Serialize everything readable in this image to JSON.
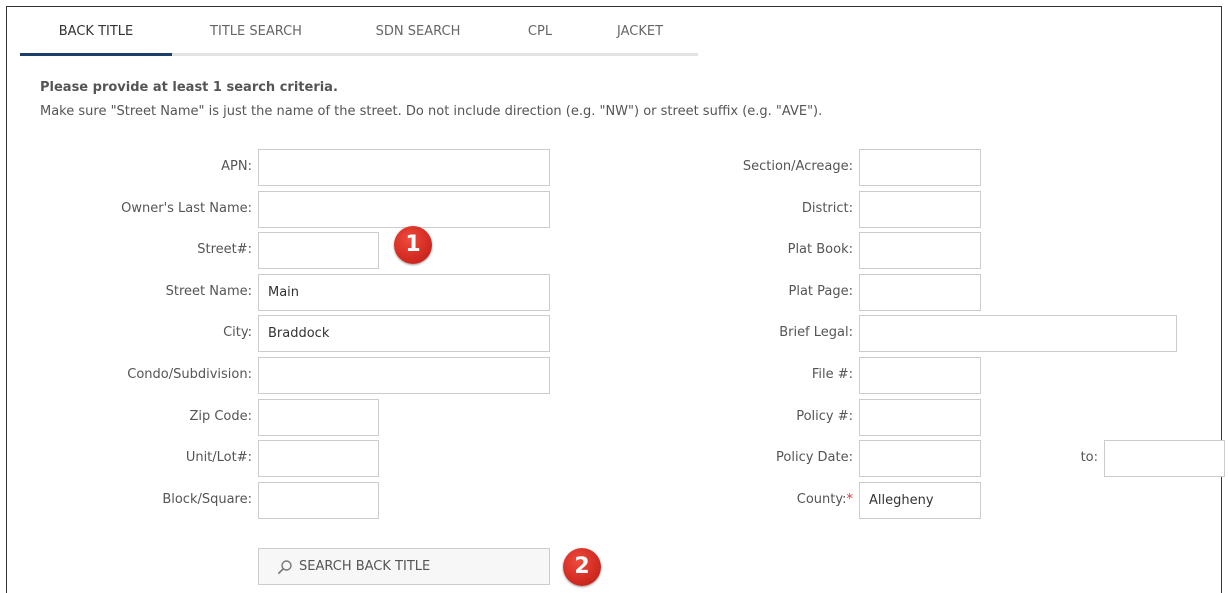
{
  "tabs": [
    {
      "label": "BACK TITLE",
      "active": true
    },
    {
      "label": "TITLE SEARCH",
      "active": false
    },
    {
      "label": "SDN SEARCH",
      "active": false
    },
    {
      "label": "CPL",
      "active": false
    },
    {
      "label": "JACKET",
      "active": false
    }
  ],
  "messages": {
    "required": "Please provide at least 1 search criteria.",
    "info": "Make sure \"Street Name\" is just the name of the street. Do not include direction (e.g. \"NW\") or street suffix (e.g. \"AVE\")."
  },
  "left_fields": {
    "apn": {
      "label": "APN:",
      "value": ""
    },
    "owner_last_name": {
      "label": "Owner's Last Name:",
      "value": ""
    },
    "street_number": {
      "label": "Street#:",
      "value": ""
    },
    "street_name": {
      "label": "Street Name:",
      "value": "Main"
    },
    "city": {
      "label": "City:",
      "value": "Braddock"
    },
    "condo_subdivision": {
      "label": "Condo/Subdivision:",
      "value": ""
    },
    "zip_code": {
      "label": "Zip Code:",
      "value": ""
    },
    "unit_lot": {
      "label": "Unit/Lot#:",
      "value": ""
    },
    "block_square": {
      "label": "Block/Square:",
      "value": ""
    }
  },
  "right_fields": {
    "section_acreage": {
      "label": "Section/Acreage:",
      "value": ""
    },
    "district": {
      "label": "District:",
      "value": ""
    },
    "plat_book": {
      "label": "Plat Book:",
      "value": ""
    },
    "plat_page": {
      "label": "Plat Page:",
      "value": ""
    },
    "brief_legal": {
      "label": "Brief Legal:",
      "value": ""
    },
    "file_number": {
      "label": "File #:",
      "value": ""
    },
    "policy_number": {
      "label": "Policy #:",
      "value": ""
    },
    "policy_date": {
      "label": "Policy Date:",
      "value": ""
    },
    "policy_date_to": {
      "label": "to:",
      "value": ""
    },
    "county": {
      "label": "County:",
      "required_mark": "*",
      "value": "Allegheny"
    }
  },
  "search_button": {
    "label": "SEARCH BACK TITLE",
    "icon": "search-icon"
  },
  "annotations": {
    "badge1": "1",
    "badge2": "2",
    "color": "#d22b22"
  },
  "colors": {
    "active_tab": "#1b3f66",
    "required": "#d9363e"
  }
}
